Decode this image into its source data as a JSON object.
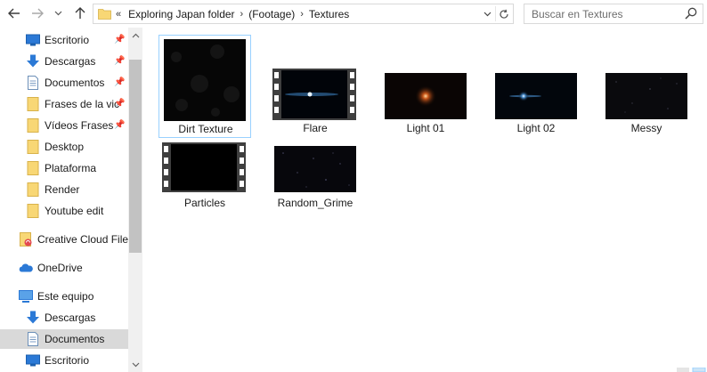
{
  "window": {
    "nav": {
      "back_icon": "back-arrow-icon",
      "forward_icon": "forward-arrow-icon",
      "history_icon": "chevron-down-icon",
      "up_icon": "up-arrow-icon"
    },
    "address": {
      "lead": "«",
      "crumbs": [
        "Exploring Japan folder",
        "(Footage)",
        "Textures"
      ],
      "separator": "›"
    },
    "search": {
      "placeholder": "Buscar en Textures"
    }
  },
  "sidebar": {
    "items": [
      {
        "label": "Escritorio",
        "icon": "desktop-icon",
        "pinned": true
      },
      {
        "label": "Descargas",
        "icon": "download-icon",
        "pinned": true
      },
      {
        "label": "Documentos",
        "icon": "document-icon",
        "pinned": true
      },
      {
        "label": "Frases de la vic",
        "icon": "folder-icon",
        "pinned": true
      },
      {
        "label": "Vídeos Frases",
        "icon": "folder-icon",
        "pinned": true
      },
      {
        "label": "Desktop",
        "icon": "folder-icon",
        "pinned": false
      },
      {
        "label": "Plataforma",
        "icon": "folder-icon",
        "pinned": false
      },
      {
        "label": "Render",
        "icon": "folder-icon",
        "pinned": false
      },
      {
        "label": "Youtube edit",
        "icon": "folder-icon",
        "pinned": false
      },
      {
        "label": "Creative Cloud Files",
        "icon": "creative-cloud-icon",
        "pinned": false
      },
      {
        "label": "OneDrive",
        "icon": "onedrive-icon",
        "pinned": false
      },
      {
        "label": "Este equipo",
        "icon": "computer-icon",
        "pinned": false
      },
      {
        "label": "Descargas",
        "icon": "download-icon",
        "pinned": false
      },
      {
        "label": "Documentos",
        "icon": "document-icon",
        "pinned": false,
        "selected": true
      },
      {
        "label": "Escritorio",
        "icon": "desktop-icon",
        "pinned": false
      }
    ]
  },
  "files": [
    {
      "name": "Dirt Texture",
      "kind": "image",
      "selected": true
    },
    {
      "name": "Flare",
      "kind": "video"
    },
    {
      "name": "Light 01",
      "kind": "image"
    },
    {
      "name": "Light 02",
      "kind": "image"
    },
    {
      "name": "Messy",
      "kind": "image"
    },
    {
      "name": "Particles",
      "kind": "video"
    },
    {
      "name": "Random_Grime",
      "kind": "image"
    }
  ],
  "colors": {
    "selection_border": "#99d1ff",
    "nav_selected": "#d9d9d9",
    "folder_yellow": "#f8d775",
    "accent_blue": "#2b79d6"
  }
}
